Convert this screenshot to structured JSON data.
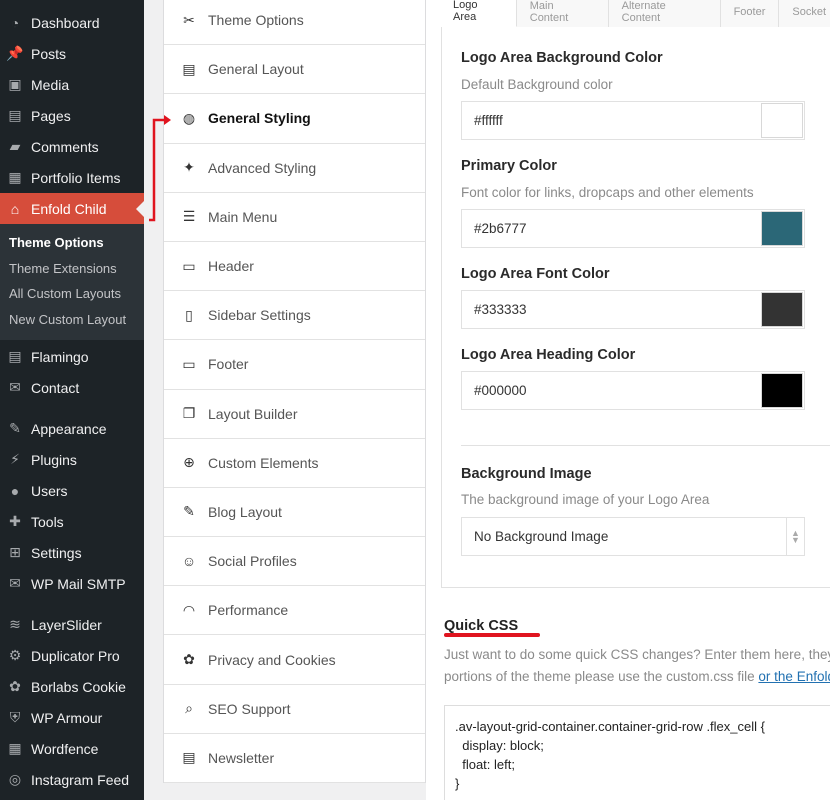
{
  "wp_menu": {
    "items": [
      {
        "label": "Dashboard",
        "icon": "dashboard-icon"
      },
      {
        "label": "Posts",
        "icon": "pin-icon"
      },
      {
        "label": "Media",
        "icon": "media-icon"
      },
      {
        "label": "Pages",
        "icon": "pages-icon"
      },
      {
        "label": "Comments",
        "icon": "comment-icon"
      },
      {
        "label": "Portfolio Items",
        "icon": "portfolio-icon"
      },
      {
        "label": "Enfold Child",
        "icon": "home-icon"
      }
    ],
    "submenu": [
      "Theme Options",
      "Theme Extensions",
      "All Custom Layouts",
      "New Custom Layout"
    ],
    "items2": [
      {
        "label": "Flamingo",
        "icon": "flamingo-icon"
      },
      {
        "label": "Contact",
        "icon": "mail-icon"
      }
    ],
    "items3": [
      {
        "label": "Appearance",
        "icon": "brush-icon"
      },
      {
        "label": "Plugins",
        "icon": "plug-icon"
      },
      {
        "label": "Users",
        "icon": "user-icon"
      },
      {
        "label": "Tools",
        "icon": "wrench-icon"
      },
      {
        "label": "Settings",
        "icon": "settings-icon"
      },
      {
        "label": "WP Mail SMTP",
        "icon": "mail-smtp-icon"
      }
    ],
    "items4": [
      {
        "label": "LayerSlider",
        "icon": "layers-icon"
      },
      {
        "label": "Duplicator Pro",
        "icon": "duplicator-icon"
      },
      {
        "label": "Borlabs Cookie",
        "icon": "cookie-icon"
      },
      {
        "label": "WP Armour",
        "icon": "shield-icon"
      },
      {
        "label": "Wordfence",
        "icon": "wordfence-icon"
      },
      {
        "label": "Instagram Feed",
        "icon": "instagram-icon"
      }
    ]
  },
  "options_menu": [
    {
      "label": "Theme Options",
      "icon": "tools-icon"
    },
    {
      "label": "General Layout",
      "icon": "layout-icon"
    },
    {
      "label": "General Styling",
      "icon": "palette-icon"
    },
    {
      "label": "Advanced Styling",
      "icon": "magic-wand-icon"
    },
    {
      "label": "Main Menu",
      "icon": "list-icon"
    },
    {
      "label": "Header",
      "icon": "header-icon"
    },
    {
      "label": "Sidebar Settings",
      "icon": "sidebar-icon"
    },
    {
      "label": "Footer",
      "icon": "footer-icon"
    },
    {
      "label": "Layout Builder",
      "icon": "layout-builder-icon"
    },
    {
      "label": "Custom Elements",
      "icon": "custom-elements-icon"
    },
    {
      "label": "Blog Layout",
      "icon": "blog-icon"
    },
    {
      "label": "Social Profiles",
      "icon": "social-icon"
    },
    {
      "label": "Performance",
      "icon": "gauge-icon"
    },
    {
      "label": "Privacy and Cookies",
      "icon": "cookie-icon"
    },
    {
      "label": "SEO Support",
      "icon": "search-icon"
    },
    {
      "label": "Newsletter",
      "icon": "newsletter-icon"
    }
  ],
  "tabs": [
    "Logo Area",
    "Main Content",
    "Alternate Content",
    "Footer",
    "Socket"
  ],
  "fields": {
    "bg_color": {
      "title": "Logo Area Background Color",
      "desc": "Default Background color",
      "value": "#ffffff",
      "swatch": "#ffffff"
    },
    "primary_color": {
      "title": "Primary Color",
      "desc": "Font color for links, dropcaps and other elements",
      "value": "#2b6777",
      "swatch": "#2b6777"
    },
    "font_color": {
      "title": "Logo Area Font Color",
      "value": "#333333",
      "swatch": "#333333"
    },
    "heading_color": {
      "title": "Logo Area Heading Color",
      "value": "#000000",
      "swatch": "#000000"
    },
    "bg_image": {
      "title": "Background Image",
      "desc": "The background image of your Logo Area",
      "value": "No Background Image"
    }
  },
  "quick_css": {
    "title": "Quick CSS",
    "desc_line1": "Just want to do some quick CSS changes? Enter them here, they w",
    "desc_line2": "portions of the theme please use the custom.css file ",
    "desc_link": "or the Enfold",
    "code": ".av-layout-grid-container.container-grid-row .flex_cell {\n  display: block;\n  float: left;\n}"
  },
  "colors": {
    "accent": "#d64d3b",
    "annotation": "#e0141f"
  }
}
